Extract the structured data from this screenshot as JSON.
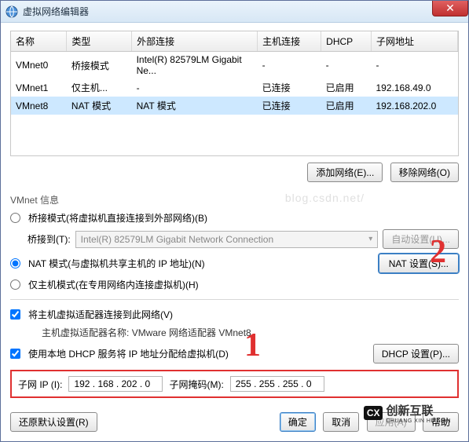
{
  "title": "虚拟网络编辑器",
  "table": {
    "headers": {
      "name": "名称",
      "type": "类型",
      "ext": "外部连接",
      "host": "主机连接",
      "dhcp": "DHCP",
      "subnet": "子网地址"
    },
    "rows": [
      {
        "name": "VMnet0",
        "type": "桥接模式",
        "ext": "Intel(R) 82579LM Gigabit Ne...",
        "host": "-",
        "dhcp": "-",
        "subnet": "-"
      },
      {
        "name": "VMnet1",
        "type": "仅主机...",
        "ext": "-",
        "host": "已连接",
        "dhcp": "已启用",
        "subnet": "192.168.49.0"
      },
      {
        "name": "VMnet8",
        "type": "NAT 模式",
        "ext": "NAT 模式",
        "host": "已连接",
        "dhcp": "已启用",
        "subnet": "192.168.202.0"
      }
    ]
  },
  "buttons": {
    "add_net": "添加网络(E)...",
    "remove_net": "移除网络(O)",
    "auto_setting": "自动设置(U)...",
    "nat_setting": "NAT 设置(S)...",
    "dhcp_setting": "DHCP 设置(P)...",
    "restore": "还原默认设置(R)",
    "ok": "确定",
    "cancel": "取消",
    "apply": "应用(A)",
    "help": "帮助"
  },
  "group": {
    "header": "VMnet 信息",
    "bridge": "桥接模式(将虚拟机直接连接到外部网络)(B)",
    "bridge_to": "桥接到(T):",
    "bridge_combo": "Intel(R) 82579LM Gigabit Network Connection",
    "nat": "NAT 模式(与虚拟机共享主机的 IP 地址)(N)",
    "hostonly": "仅主机模式(在专用网络内连接虚拟机)(H)",
    "connect_host": "将主机虚拟适配器连接到此网络(V)",
    "adapter_label": "主机虚拟适配器名称:",
    "adapter_name": "VMware 网络适配器 VMnet8",
    "use_dhcp": "使用本地 DHCP 服务将 IP 地址分配给虚拟机(D)"
  },
  "ip": {
    "subnet_label": "子网 IP (I):",
    "subnet_value": "192 . 168 . 202 .  0",
    "mask_label": "子网掩码(M):",
    "mask_value": "255 . 255 . 255 .  0"
  },
  "watermark": "blog.csdn.net/",
  "brand": {
    "logo": "CX",
    "text": "创新互联",
    "sub": "CHUANG XIN HU LIAN"
  }
}
